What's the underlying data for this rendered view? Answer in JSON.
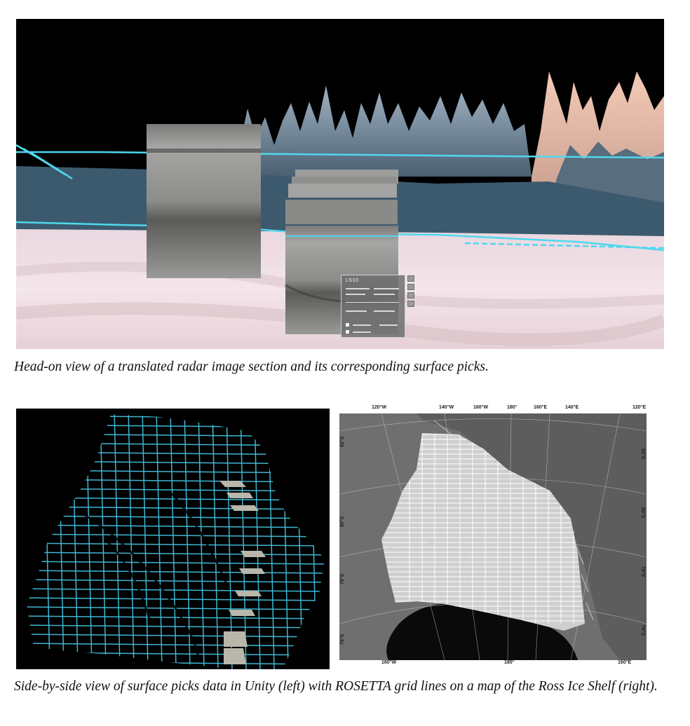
{
  "figure1": {
    "caption": "Head-on view of a translated radar image section and its corresponding surface picks.",
    "panel_title": "LS10",
    "colors": {
      "sky": "#000000",
      "ice": "#3c5a6e",
      "picks": "#4fd8ee",
      "ground": "#efdfe6",
      "radar": "#8a8a88"
    }
  },
  "figure2": {
    "caption": "Side-by-side view of surface picks data in Unity (left) with ROSETTA grid lines on a map of the Ross Ice Shelf (right).",
    "map": {
      "top_longitudes": [
        "120°W",
        "140°W",
        "160°W",
        "180°",
        "160°E",
        "140°E",
        "120°E"
      ],
      "bottom_longitudes": [
        "160°W",
        "180°",
        "160°E"
      ],
      "left_latitudes": [
        "82°S",
        "80°S",
        "78°S",
        "76°S"
      ],
      "right_latitudes": [
        "82°S",
        "80°S",
        "78°S",
        "76°S"
      ]
    },
    "colors": {
      "grid": "#3fb6d2",
      "map_bg": "#6f6f6f",
      "ice_shelf": "#cfcfcf",
      "ocean": "#0a0a0a"
    }
  }
}
